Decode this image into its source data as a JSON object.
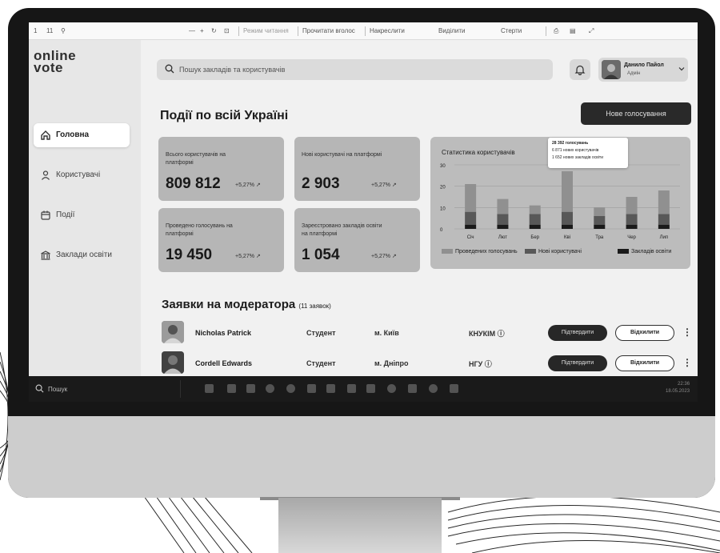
{
  "browser": {
    "tab_nums": [
      "1",
      "11"
    ],
    "reading_view": "Режим читання",
    "read_aloud": "Прочитати вголос",
    "draw": "Накреслити",
    "highlight": "Виділити",
    "erase": "Стерти"
  },
  "sidebar": {
    "logo_top": "online",
    "logo_bottom": "vote",
    "items": [
      {
        "label": "Головна",
        "icon": "home-icon",
        "active": true
      },
      {
        "label": "Користувачі",
        "icon": "user-icon",
        "active": false
      },
      {
        "label": "Події",
        "icon": "calendar-icon",
        "active": false
      },
      {
        "label": "Заклади освіти",
        "icon": "building-icon",
        "active": false
      }
    ]
  },
  "header": {
    "search_placeholder": "Пошук закладів та користувачів",
    "user_name": "Данило Пайол",
    "user_role": "Адмін"
  },
  "main": {
    "title": "Події по всій Україні",
    "new_vote": "Нове голосування",
    "stats": [
      {
        "label": "Всього користувачів на платформі",
        "value": "809 812",
        "change": "+5,27%"
      },
      {
        "label": "Нові користувачі на платформі",
        "value": "2 903",
        "change": "+5,27%"
      },
      {
        "label": "Проведено голосувань на платформі",
        "value": "19 450",
        "change": "+5,27%"
      },
      {
        "label": "Зареєстровано закладів освіти на платформі",
        "value": "1 054",
        "change": "+5,27%"
      }
    ]
  },
  "chart": {
    "title": "Статистика користувачів",
    "tooltip": [
      "28 392 голосувань",
      "6 871 нових користувачів",
      "1 652 нових закладів освіти"
    ]
  },
  "chart_data": {
    "type": "bar",
    "title": "Статистика користувачів",
    "categories": [
      "Січ",
      "Лют",
      "Бер",
      "Кві",
      "Тра",
      "Чер",
      "Лип"
    ],
    "ylim": [
      0,
      30
    ],
    "yticks": [
      0,
      10,
      20,
      30
    ],
    "stacked": true,
    "series": [
      {
        "name": "Проведених голосувань",
        "color": "#8f8f8f",
        "values": [
          13,
          7,
          4,
          19,
          4,
          8,
          11
        ]
      },
      {
        "name": "Нові користувачі",
        "color": "#5a5a5a",
        "values": [
          6,
          5,
          5,
          6,
          4,
          5,
          5
        ]
      },
      {
        "name": "Закладів освіти",
        "color": "#1f1f1f",
        "values": [
          2,
          2,
          2,
          2,
          2,
          2,
          2
        ]
      }
    ],
    "legend_position": "bottom"
  },
  "moderation": {
    "title": "Заявки на модератора",
    "count": "(11 заявок)",
    "approve": "Підтвердити",
    "reject": "Відхилити",
    "rows": [
      {
        "name": "Nicholas Patrick",
        "role": "Студент",
        "city": "м. Київ",
        "uni": "КНУКІМ"
      },
      {
        "name": "Cordell Edwards",
        "role": "Студент",
        "city": "м. Дніпро",
        "uni": "НГУ"
      }
    ]
  },
  "taskbar": {
    "search_placeholder": "Пошук",
    "time": "22:36",
    "date": "18.05.2023"
  }
}
